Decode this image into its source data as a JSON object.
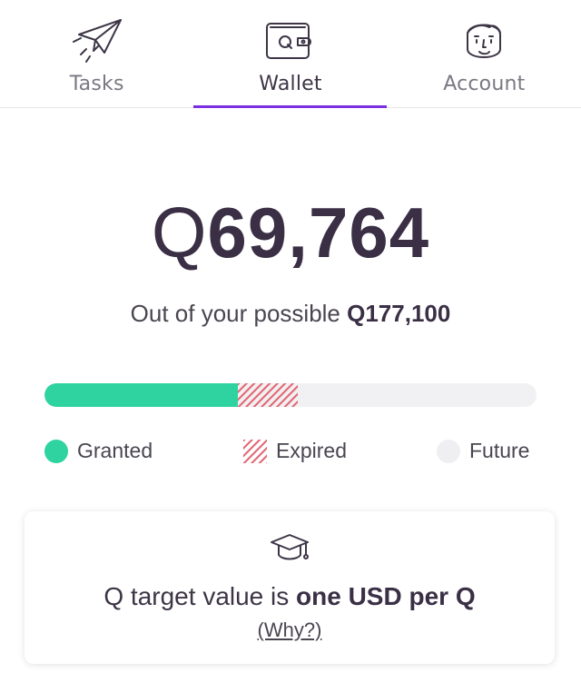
{
  "tabs": [
    {
      "label": "Tasks",
      "icon": "paper-plane-icon"
    },
    {
      "label": "Wallet",
      "icon": "wallet-icon",
      "active": true
    },
    {
      "label": "Account",
      "icon": "face-icon"
    }
  ],
  "balance": {
    "symbol": "Q",
    "amount": "69,764"
  },
  "possible": {
    "text": "Out of your possible ",
    "amount": "Q177,100"
  },
  "progress": {
    "granted_fraction": 0.393,
    "expired_fraction": 0.122
  },
  "legend": {
    "granted": "Granted",
    "expired": "Expired",
    "future": "Future"
  },
  "colors": {
    "accent": "#7b2fe0",
    "granted": "#2ed3a0",
    "expired": "#e46a78",
    "future": "#efeff1"
  },
  "info": {
    "icon": "graduation-cap-icon",
    "prefix": "Q target value is ",
    "emphasis": "one USD per Q",
    "link": "(Why?)"
  }
}
